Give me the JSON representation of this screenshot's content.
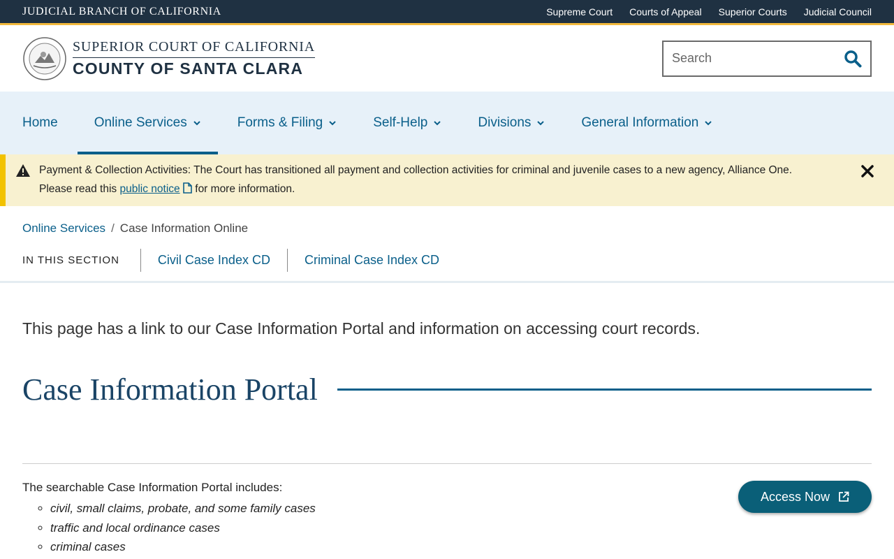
{
  "topbar": {
    "branch": "JUDICIAL BRANCH OF CALIFORNIA",
    "links": [
      "Supreme Court",
      "Courts of Appeal",
      "Superior Courts",
      "Judicial Council"
    ]
  },
  "header": {
    "title_top": "SUPERIOR COURT OF CALIFORNIA",
    "title_bottom": "COUNTY OF SANTA CLARA",
    "search_placeholder": "Search"
  },
  "nav": {
    "items": [
      {
        "label": "Home",
        "dropdown": false
      },
      {
        "label": "Online Services",
        "dropdown": true
      },
      {
        "label": "Forms & Filing",
        "dropdown": true
      },
      {
        "label": "Self-Help",
        "dropdown": true
      },
      {
        "label": "Divisions",
        "dropdown": true
      },
      {
        "label": "General Information",
        "dropdown": true
      }
    ]
  },
  "alert": {
    "title": "Payment & Collection Activities:",
    "body": " The Court has transitioned all payment and collection activities for criminal and juvenile cases to a new agency, Alliance One. Please read this ",
    "link": "public notice",
    "tail": " for more information."
  },
  "breadcrumb": {
    "parent": "Online Services",
    "separator": "/",
    "current": "Case Information Online"
  },
  "section_nav": {
    "label": "IN THIS SECTION",
    "links": [
      "Civil Case Index CD",
      "Criminal Case Index CD"
    ]
  },
  "main": {
    "intro": "This page has a link to our Case Information Portal and information on accessing court records.",
    "heading": "Case Information Portal",
    "portal_intro": "The searchable Case Information Portal includes:",
    "portal_items": [
      " civil, small claims, probate, and some family cases",
      "traffic and local ordinance cases",
      "criminal cases"
    ],
    "access_button": "Access Now"
  },
  "colors": {
    "topbar": "#1f3142",
    "accent_gold": "#f2b93d",
    "link_blue": "#0a5f8a",
    "nav_bg": "#e7f1f9",
    "alert_bg": "#f8f1d0",
    "button_bg": "#0a5f78"
  }
}
